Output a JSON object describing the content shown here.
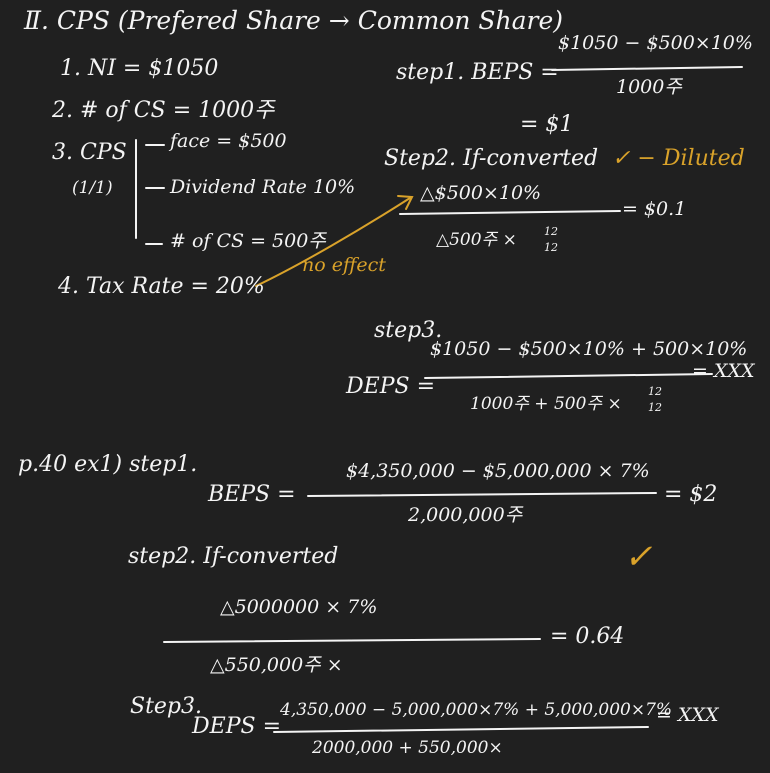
{
  "colors": {
    "background": "#202020",
    "ink": "#f4f4f4",
    "highlight": "#d9a22a"
  },
  "section_title": "Ⅱ. CPS (Prefered Share → Common Share)",
  "givens": {
    "ni": "1. NI = $1050",
    "cs": "2. # of CS = 1000주",
    "cps": "3. CPS",
    "cps_note": "(1/1)",
    "face": "face = $500",
    "div_rate": "Dividend Rate 10%",
    "cs_count": "# of CS = 500주",
    "tax": "4. Tax Rate = 20%",
    "no_effect": "no effect"
  },
  "ex1": {
    "step1_label": "step1. BEPS =",
    "step1_num": "$1050 − $500×10%",
    "step1_den": "1000주",
    "step1_result": "= $1",
    "step2_label": "Step2. If-converted",
    "diluted": "✓ − Diluted",
    "step2_num": "△$500×10%",
    "step2_den_base": "△500주 ×",
    "frac_num": "12",
    "frac_den": "12",
    "step2_result": "= $0.1",
    "step3_label": "step3.",
    "deps_label": "DEPS =",
    "step3_num": "$1050 − $500×10% + 500×10%",
    "step3_den_base": "1000주 + 500주 ×",
    "step3_result": "= XXX"
  },
  "ex2": {
    "ref": "p.40 ex1) step1.",
    "beps_label": "BEPS =",
    "step1_num": "$4,350,000 − $5,000,000 × 7%",
    "step1_den": "2,000,000주",
    "step1_result": "= $2",
    "check": "✓",
    "step2_label": "step2. If-converted",
    "step2_num": "△5000000 × 7%",
    "step2_den_base": "△550,000주 ×",
    "step2_result": "= 0.64",
    "step3_label": "Step3.",
    "deps_label": "DEPS =",
    "step3_num": "4,350,000 − 5,000,000×7% + 5,000,000×7%",
    "step3_den_base": "2000,000 + 550,000×",
    "step3_result": "= XXX"
  }
}
